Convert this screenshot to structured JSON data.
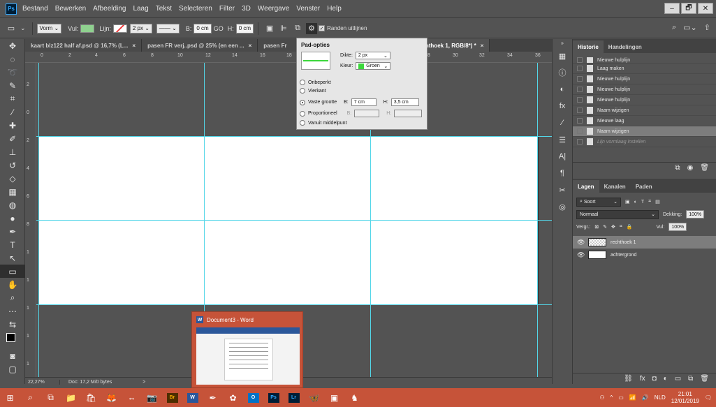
{
  "app": {
    "logo": "Ps",
    "menu": [
      "Bestand",
      "Bewerken",
      "Afbeelding",
      "Laag",
      "Tekst",
      "Selecteren",
      "Filter",
      "3D",
      "Weergave",
      "Venster",
      "Help"
    ],
    "window_controls": [
      "–",
      "🗗",
      "✕"
    ]
  },
  "options_bar": {
    "mode": "Vorm",
    "fill_label": "Vul:",
    "stroke_label": "Lijn:",
    "stroke_width": "2 px",
    "w_label": "B:",
    "w_value": "0 cm",
    "link_label": "GO",
    "h_label": "H:",
    "h_value": "0 cm",
    "align_edges": "Randen uitlijnen",
    "fill_color": "#8fd18f",
    "right_icons": [
      "search-icon",
      "workspace-icon",
      "share-icon"
    ]
  },
  "tabs": [
    {
      "label": "kaart blz122 half af.psd @ 16,7% (L...",
      "active": false
    },
    {
      "label": "pasen FR verj..psd @ 25% (en een ...",
      "active": false
    },
    {
      "label": "pasen Fr",
      "active": false
    },
    {
      "label": "@ 22,3% (rechthoek 1, RGB/8*) *",
      "active": true
    }
  ],
  "ruler_top": [
    "0",
    "2",
    "4",
    "6",
    "8",
    "10",
    "12",
    "14",
    "16",
    "18",
    "28",
    "30",
    "32",
    "34",
    "36"
  ],
  "ruler_left": [
    "2",
    "0",
    "2",
    "4",
    "6",
    "8",
    "1",
    "1",
    "1",
    "1",
    "1"
  ],
  "path_options": {
    "title": "Pad-opties",
    "thickness_label": "Dikte:",
    "thickness_value": "2 px",
    "color_label": "Kleur:",
    "color_value": "Groen",
    "color_hex": "#3cd83c",
    "options": [
      {
        "label": "Onbeperkt",
        "checked": false
      },
      {
        "label": "Vierkant",
        "checked": false
      },
      {
        "label": "Vaste grootte",
        "checked": true
      },
      {
        "label": "Proportioneel",
        "checked": false
      },
      {
        "label": "Vanuit middelpunt",
        "checked": false
      }
    ],
    "b_label": "B:",
    "b_value": "7 cm",
    "h_label": "H:",
    "h_value": "3,5 cm",
    "prop_b_label": "B:",
    "prop_h_label": "H:"
  },
  "status": {
    "zoom": "22,27%",
    "doc": "Doc: 17,2 M/0 bytes",
    "arrow": ">"
  },
  "history": {
    "tabs": [
      "Historie",
      "Handelingen"
    ],
    "rows": [
      {
        "label": "Nieuwe hulplijn",
        "state": "partial"
      },
      {
        "label": "Laag maken",
        "state": "normal"
      },
      {
        "label": "Nieuwe hulplijn",
        "state": "normal"
      },
      {
        "label": "Nieuwe hulplijn",
        "state": "normal"
      },
      {
        "label": "Nieuwe hulplijn",
        "state": "normal"
      },
      {
        "label": "Naam wijzigen",
        "state": "normal"
      },
      {
        "label": "Nieuwe laag",
        "state": "normal"
      },
      {
        "label": "Naam wijzigen",
        "state": "selected"
      },
      {
        "label": "Lijn vormlaag instellen",
        "state": "dim"
      }
    ]
  },
  "layers": {
    "tabs": [
      "Lagen",
      "Kanalen",
      "Paden"
    ],
    "filter": "Soort",
    "blend_mode": "Normaal",
    "opacity_label": "Dekking:",
    "opacity_value": "100%",
    "lock_label": "Vergr.:",
    "fill_label": "Vul:",
    "fill_value": "100%",
    "items": [
      {
        "name": "rechthoek 1",
        "selected": true
      },
      {
        "name": "achtergrond",
        "selected": false
      }
    ]
  },
  "word_preview": {
    "title": "Document3 - Word"
  },
  "taskbar": {
    "time": "21:01",
    "date": "12/01/2019",
    "lang": "NLD"
  }
}
